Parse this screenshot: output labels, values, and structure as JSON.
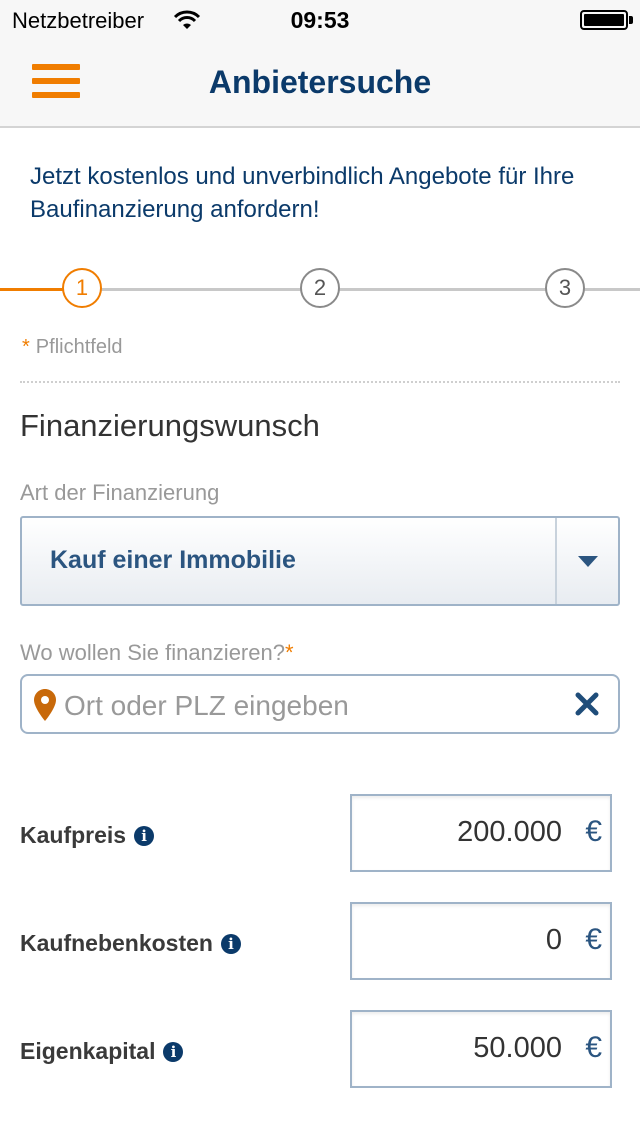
{
  "status_bar": {
    "carrier": "Netzbetreiber",
    "time": "09:53"
  },
  "nav": {
    "title": "Anbietersuche",
    "menu_icon": "hamburger-menu-icon"
  },
  "intro": "Jetzt kostenlos und unverbindlich Angebote für Ihre Baufinanzierung anfordern!",
  "stepper": {
    "steps": [
      "1",
      "2",
      "3"
    ],
    "active_step": 1
  },
  "required_note": {
    "star": "*",
    "text": "Pflichtfeld"
  },
  "section_title": "Finanzierungswunsch",
  "financing_type": {
    "label": "Art der Finanzierung",
    "selected": "Kauf einer Immobilie"
  },
  "location": {
    "label": "Wo wollen Sie finanzieren?",
    "required_star": "*",
    "placeholder": "Ort oder PLZ eingeben",
    "value": ""
  },
  "amounts": [
    {
      "label": "Kaufpreis",
      "value": "200.000",
      "currency": "€"
    },
    {
      "label": "Kaufnebenkosten",
      "value": "0",
      "currency": "€"
    },
    {
      "label": "Eigenkapital",
      "value": "50.000",
      "currency": "€"
    }
  ],
  "colors": {
    "accent": "#f07d00",
    "brand": "#0b3a6a",
    "field_text": "#2b5580"
  }
}
